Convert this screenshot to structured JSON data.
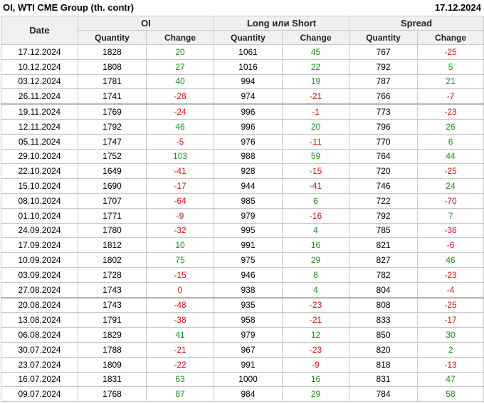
{
  "header": {
    "title": "OI, WTI CME Group (th. contr)",
    "date": "17.12.2024"
  },
  "columns": {
    "date": "Date",
    "groups": [
      "OI",
      "Long или Short",
      "Spread"
    ],
    "sub": [
      "Quantity",
      "Change",
      "Quantity",
      "Change",
      "Quantity",
      "Change"
    ]
  },
  "separator_rows": [
    4,
    17
  ],
  "rows": [
    {
      "date": "17.12.2024",
      "oi_q": "1828",
      "oi_c": "20",
      "ls_q": "1061",
      "ls_c": "45",
      "sp_q": "767",
      "sp_c": "-25"
    },
    {
      "date": "10.12.2024",
      "oi_q": "1808",
      "oi_c": "27",
      "ls_q": "1016",
      "ls_c": "22",
      "sp_q": "792",
      "sp_c": "5"
    },
    {
      "date": "03.12.2024",
      "oi_q": "1781",
      "oi_c": "40",
      "ls_q": "994",
      "ls_c": "19",
      "sp_q": "787",
      "sp_c": "21"
    },
    {
      "date": "26.11.2024",
      "oi_q": "1741",
      "oi_c": "-28",
      "ls_q": "974",
      "ls_c": "-21",
      "sp_q": "766",
      "sp_c": "-7"
    },
    {
      "date": "19.11.2024",
      "oi_q": "1769",
      "oi_c": "-24",
      "ls_q": "996",
      "ls_c": "-1",
      "sp_q": "773",
      "sp_c": "-23"
    },
    {
      "date": "12.11.2024",
      "oi_q": "1792",
      "oi_c": "46",
      "ls_q": "996",
      "ls_c": "20",
      "sp_q": "796",
      "sp_c": "26"
    },
    {
      "date": "05.11.2024",
      "oi_q": "1747",
      "oi_c": "-5",
      "ls_q": "976",
      "ls_c": "-11",
      "sp_q": "770",
      "sp_c": "6"
    },
    {
      "date": "29.10.2024",
      "oi_q": "1752",
      "oi_c": "103",
      "ls_q": "988",
      "ls_c": "59",
      "sp_q": "764",
      "sp_c": "44"
    },
    {
      "date": "22.10.2024",
      "oi_q": "1649",
      "oi_c": "-41",
      "ls_q": "928",
      "ls_c": "-15",
      "sp_q": "720",
      "sp_c": "-25"
    },
    {
      "date": "15.10.2024",
      "oi_q": "1690",
      "oi_c": "-17",
      "ls_q": "944",
      "ls_c": "-41",
      "sp_q": "746",
      "sp_c": "24"
    },
    {
      "date": "08.10.2024",
      "oi_q": "1707",
      "oi_c": "-64",
      "ls_q": "985",
      "ls_c": "6",
      "sp_q": "722",
      "sp_c": "-70"
    },
    {
      "date": "01.10.2024",
      "oi_q": "1771",
      "oi_c": "-9",
      "ls_q": "979",
      "ls_c": "-16",
      "sp_q": "792",
      "sp_c": "7"
    },
    {
      "date": "24.09.2024",
      "oi_q": "1780",
      "oi_c": "-32",
      "ls_q": "995",
      "ls_c": "4",
      "sp_q": "785",
      "sp_c": "-36"
    },
    {
      "date": "17.09.2024",
      "oi_q": "1812",
      "oi_c": "10",
      "ls_q": "991",
      "ls_c": "16",
      "sp_q": "821",
      "sp_c": "-6"
    },
    {
      "date": "10.09.2024",
      "oi_q": "1802",
      "oi_c": "75",
      "ls_q": "975",
      "ls_c": "29",
      "sp_q": "827",
      "sp_c": "46"
    },
    {
      "date": "03.09.2024",
      "oi_q": "1728",
      "oi_c": "-15",
      "ls_q": "946",
      "ls_c": "8",
      "sp_q": "782",
      "sp_c": "-23"
    },
    {
      "date": "27.08.2024",
      "oi_q": "1743",
      "oi_c": "0",
      "ls_q": "938",
      "ls_c": "4",
      "sp_q": "804",
      "sp_c": "-4"
    },
    {
      "date": "20.08.2024",
      "oi_q": "1743",
      "oi_c": "-48",
      "ls_q": "935",
      "ls_c": "-23",
      "sp_q": "808",
      "sp_c": "-25"
    },
    {
      "date": "13.08.2024",
      "oi_q": "1791",
      "oi_c": "-38",
      "ls_q": "958",
      "ls_c": "-21",
      "sp_q": "833",
      "sp_c": "-17"
    },
    {
      "date": "06.08.2024",
      "oi_q": "1829",
      "oi_c": "41",
      "ls_q": "979",
      "ls_c": "12",
      "sp_q": "850",
      "sp_c": "30"
    },
    {
      "date": "30.07.2024",
      "oi_q": "1788",
      "oi_c": "-21",
      "ls_q": "967",
      "ls_c": "-23",
      "sp_q": "820",
      "sp_c": "2"
    },
    {
      "date": "23.07.2024",
      "oi_q": "1809",
      "oi_c": "-22",
      "ls_q": "991",
      "ls_c": "-9",
      "sp_q": "818",
      "sp_c": "-13"
    },
    {
      "date": "16.07.2024",
      "oi_q": "1831",
      "oi_c": "63",
      "ls_q": "1000",
      "ls_c": "16",
      "sp_q": "831",
      "sp_c": "47"
    },
    {
      "date": "09.07.2024",
      "oi_q": "1768",
      "oi_c": "87",
      "ls_q": "984",
      "ls_c": "29",
      "sp_q": "784",
      "sp_c": "58"
    }
  ],
  "colors": {
    "positive": "#1e8c1e",
    "negative": "#d01414",
    "zero": "#d01414"
  }
}
